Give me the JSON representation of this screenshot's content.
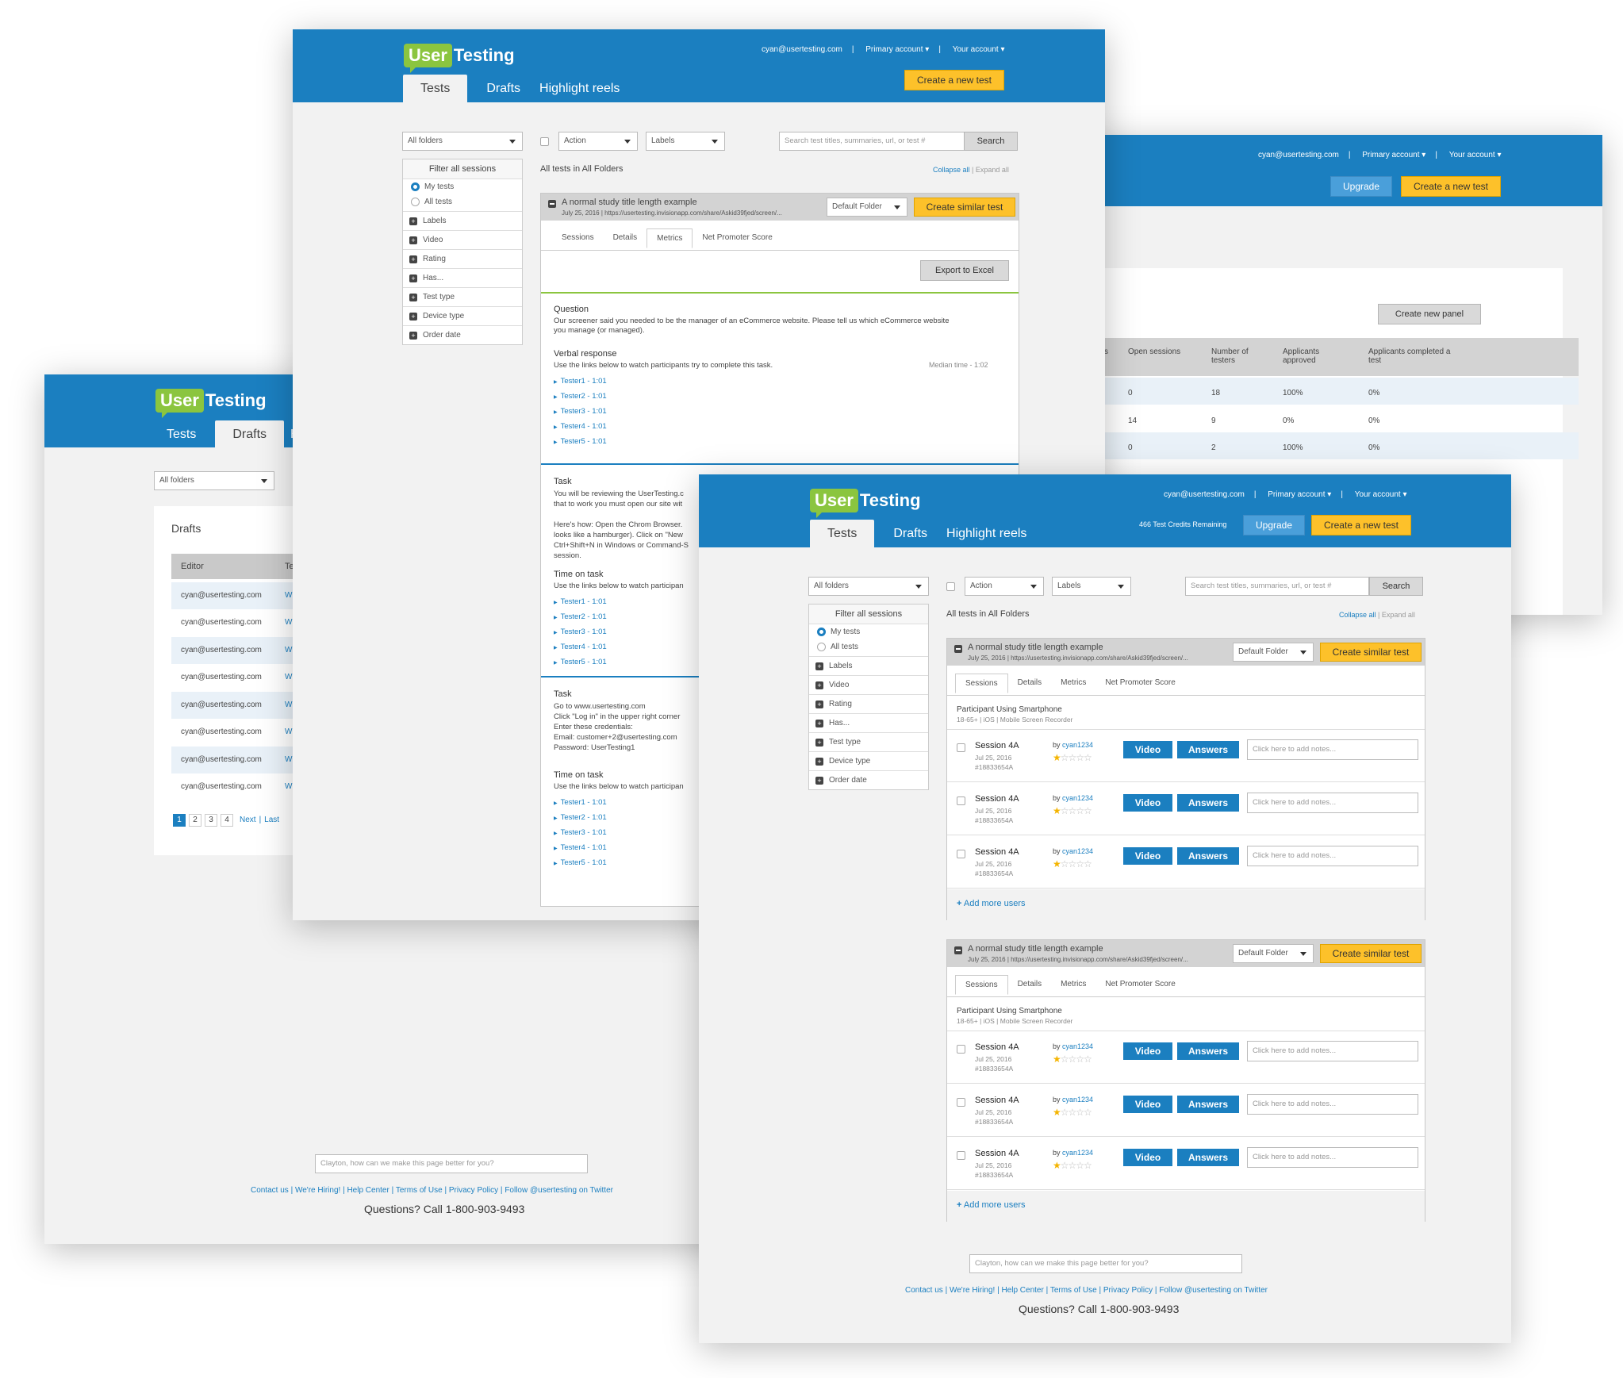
{
  "brand": {
    "logo_left": "User",
    "logo_right": "Testing"
  },
  "nav": {
    "email": "cyan@usertesting.com",
    "primary": "Primary account ▾",
    "your": "Your account ▾",
    "sep": "|",
    "create": "Create a new test",
    "upgrade": "Upgrade",
    "tabs": [
      "Tests",
      "Drafts",
      "Highlight reels"
    ],
    "h_partial": "H",
    "credits": "466 Test Credits Remaining"
  },
  "toolbar": {
    "folders": "All folders",
    "action": "Action",
    "labels": "Labels",
    "search_ph": "Search test titles, summaries, url, or test #",
    "search": "Search",
    "all_tests": "All tests in All Folders",
    "collapse": "Collapse all",
    "expand": "Expand all",
    "sep": "|"
  },
  "filter": {
    "title": "Filter all sessions",
    "my": "My tests",
    "all": "All tests",
    "items": [
      "Labels",
      "Video",
      "Rating",
      "Has...",
      "Test type",
      "Device type",
      "Order date"
    ]
  },
  "study": {
    "title": "A normal study title length example",
    "date": "July 25, 2016 | https://usertesting.invisionapp.com/share/Askid39fjed/screen/...",
    "folder": "Default Folder",
    "similar": "Create similar test",
    "subtabs": [
      "Sessions",
      "Details",
      "Metrics",
      "Net Promoter Score"
    ],
    "export": "Export to Excel"
  },
  "metrics": {
    "q_title": "Question",
    "q_text1": "Our screener said you needed to be the manager of an eCommerce website. Please tell us which eCommerce website",
    "q_text2": "you manage (or managed).",
    "vr_title": "Verbal response",
    "vr_text": "Use the links below to watch participants try to complete this task.",
    "median": "Median time - 1:02",
    "testers": [
      "Tester1 - 1:01",
      "Tester2 - 1:01",
      "Tester3 - 1:01",
      "Tester4 - 1:01",
      "Tester5 - 1:01"
    ],
    "task_title": "Task",
    "task_lines": [
      "You will be reviewing the UserTesting.c",
      "that to work you must open our site wit",
      "",
      "Here's how: Open the Chrom Browser.",
      "looks like a hamburger). Click on \"New",
      "Ctrl+Shift+N in Windows or Command-S",
      "session."
    ],
    "tot_title": "Time on task",
    "tot_text": "Use the links below to watch participan",
    "task2_lines": [
      "Go to www.usertesting.com",
      "Click \"Log in\" in the upper right corner",
      "Enter these credentials:",
      "Email: customer+2@usertesting.com",
      "Password: UserTesting1"
    ]
  },
  "panels_page": {
    "create_panel": "Create new panel",
    "headers": [
      "s",
      "Open sessions",
      "Number of testers",
      "Applicants approved",
      "Applicants completed a test"
    ],
    "rows": [
      [
        "0",
        "18",
        "100%",
        "0%"
      ],
      [
        "14",
        "9",
        "0%",
        "0%"
      ],
      [
        "0",
        "2",
        "100%",
        "0%"
      ]
    ]
  },
  "drafts": {
    "title": "Drafts",
    "col_editor": "Editor",
    "col_t": "Te",
    "emails": [
      "cyan@usertesting.com",
      "cyan@usertesting.com",
      "cyan@usertesting.com",
      "cyan@usertesting.com",
      "cyan@usertesting.com",
      "cyan@usertesting.com",
      "cyan@usertesting.com",
      "cyan@usertesting.com"
    ],
    "w": "W",
    "pages": [
      "1",
      "2",
      "3",
      "4"
    ],
    "next": "Next",
    "last": "Last"
  },
  "sessions": {
    "participant": "Participant Using Smartphone",
    "participant_meta": "18-65+ | iOS | Mobile Screen Recorder",
    "name": "Session 4A",
    "by": "by",
    "user": "cyan1234",
    "date": "Jul 25, 2016",
    "id": "#18833654A",
    "video": "Video",
    "answers": "Answers",
    "notes_ph": "Click here to add notes...",
    "add_users": "Add more users",
    "rating": 1
  },
  "footer": {
    "feedback_ph": "Clayton, how can we make this page better for you?",
    "links": [
      "Contact us",
      "We're Hiring!",
      "Help Center",
      "Terms of Use",
      "Privacy Policy",
      "Follow @usertesting on Twitter"
    ],
    "sep": "|",
    "phone": "Questions? Call 1-800-903-9493"
  }
}
